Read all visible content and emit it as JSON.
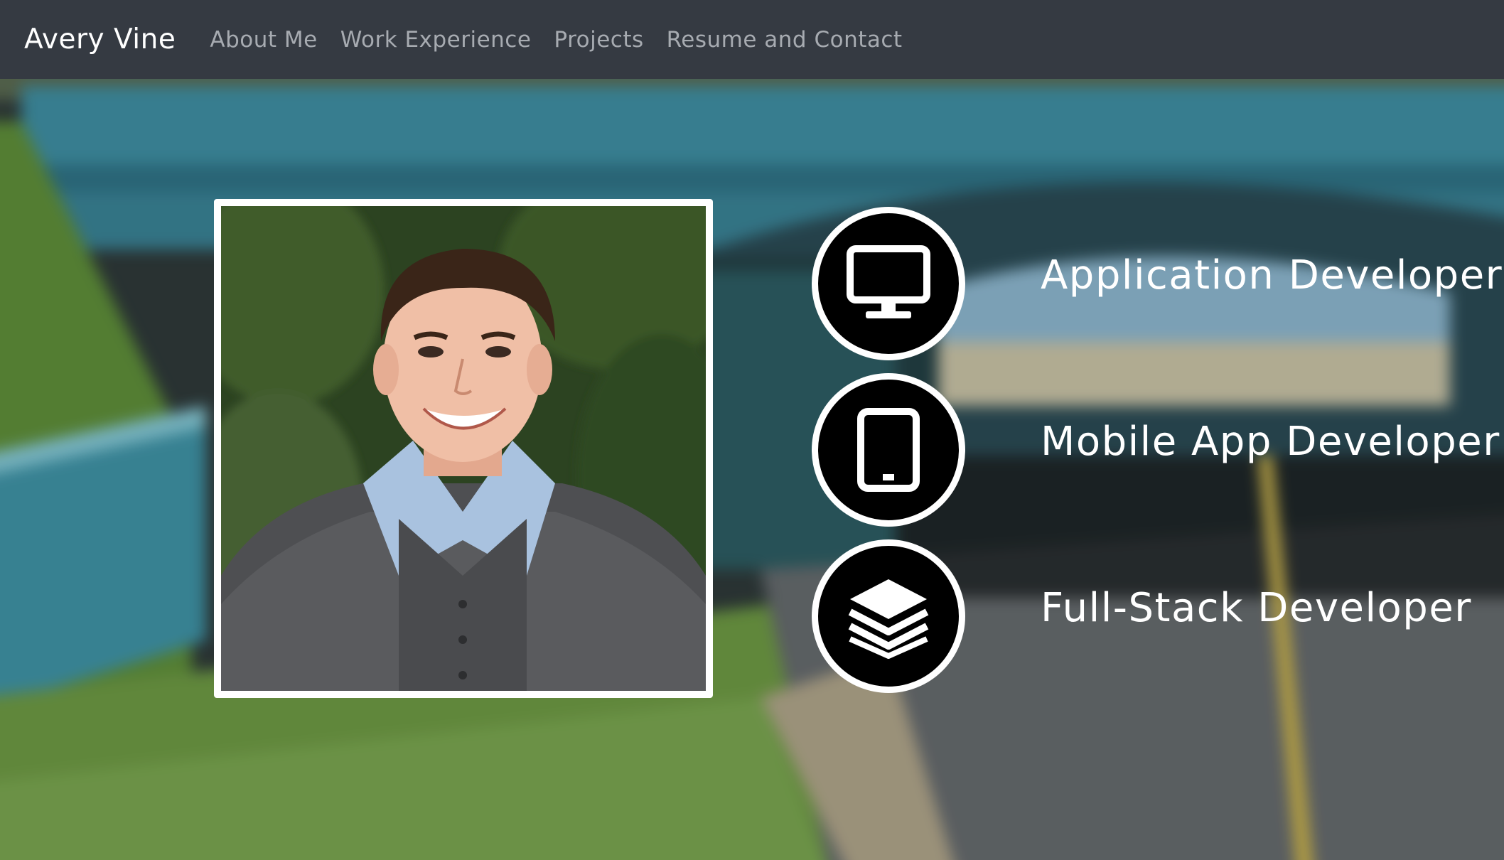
{
  "navbar": {
    "brand": "Avery Vine",
    "links": [
      "About Me",
      "Work Experience",
      "Projects",
      "Resume and Contact"
    ]
  },
  "roles": [
    {
      "label": "Application Developer",
      "icon": "monitor-icon"
    },
    {
      "label": "Mobile App Developer",
      "icon": "tablet-icon"
    },
    {
      "label": "Full-Stack Developer",
      "icon": "layers-icon"
    }
  ],
  "colors": {
    "navbar_bg": "#353a42",
    "nav_link": "#a7abb1",
    "brand": "#ffffff",
    "role_text": "#ffffff",
    "icon_circle": "#000000"
  }
}
